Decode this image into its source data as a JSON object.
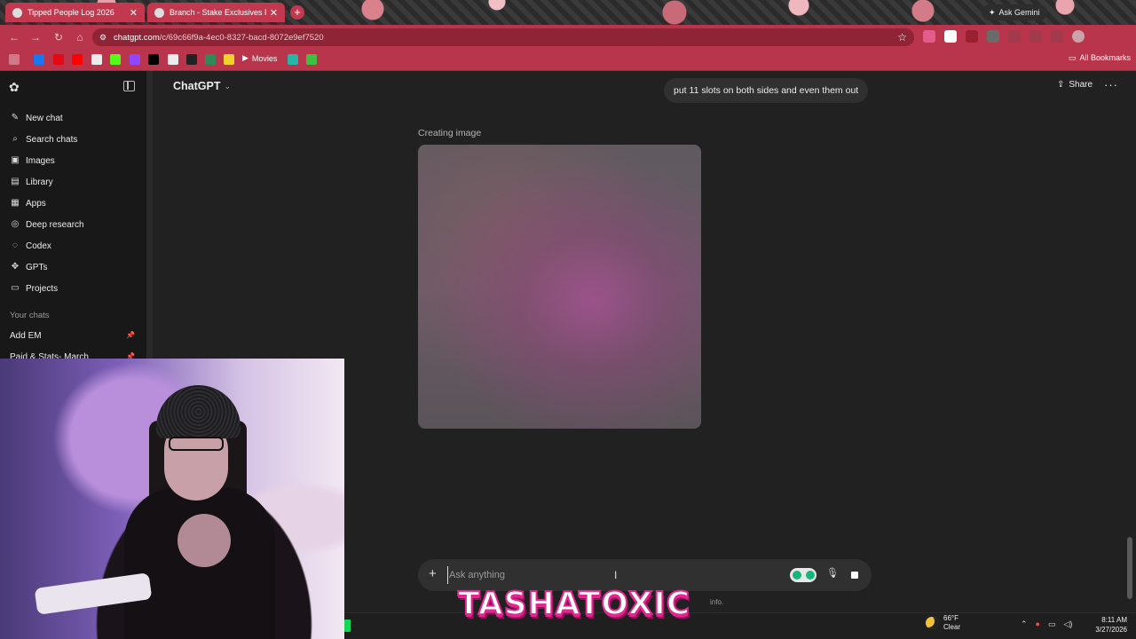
{
  "browser": {
    "tabs": [
      {
        "title": "Tipped People Log 2026"
      },
      {
        "title": "Branch - Stake Exclusives Poster"
      }
    ],
    "new_tab": "+",
    "ask_gemini": "Ask Gemini",
    "url_host": "chatgpt.com",
    "url_path": "/c/69c66f9a-4ec0-8327-bacd-8072e9ef7520",
    "bookmarks": {
      "movies": "Movies",
      "all": "All Bookmarks"
    }
  },
  "sidebar": {
    "items": [
      {
        "label": "New chat",
        "icon": "edit-icon"
      },
      {
        "label": "Search chats",
        "icon": "search-icon"
      },
      {
        "label": "Images",
        "icon": "image-icon"
      },
      {
        "label": "Library",
        "icon": "library-icon"
      },
      {
        "label": "Apps",
        "icon": "apps-icon"
      },
      {
        "label": "Deep research",
        "icon": "telescope-icon"
      },
      {
        "label": "Codex",
        "icon": "codex-icon"
      },
      {
        "label": "GPTs",
        "icon": "gpts-icon"
      },
      {
        "label": "Projects",
        "icon": "folder-icon"
      }
    ],
    "section_title": "Your chats",
    "chats": [
      {
        "label": "Add EM"
      },
      {
        "label": "Paid & Stats- March"
      }
    ]
  },
  "header": {
    "model": "ChatGPT",
    "share": "Share"
  },
  "conversation": {
    "user_message": "put 11 slots on both sides and even them out",
    "status": "Creating image"
  },
  "composer": {
    "placeholder": "Ask anything",
    "footer": "info."
  },
  "stream_overlay": {
    "name": "TASHATOXIC"
  },
  "taskbar": {
    "temperature": "66°F",
    "condition": "Clear",
    "time": "8:11 AM",
    "date": "3/27/2026"
  },
  "colors": {
    "tab_bg": "#c2394f",
    "address_bar": "#b8354b",
    "sidebar_bg": "#181818",
    "main_bg": "#212121",
    "overlay_pink": "#e2268f"
  }
}
